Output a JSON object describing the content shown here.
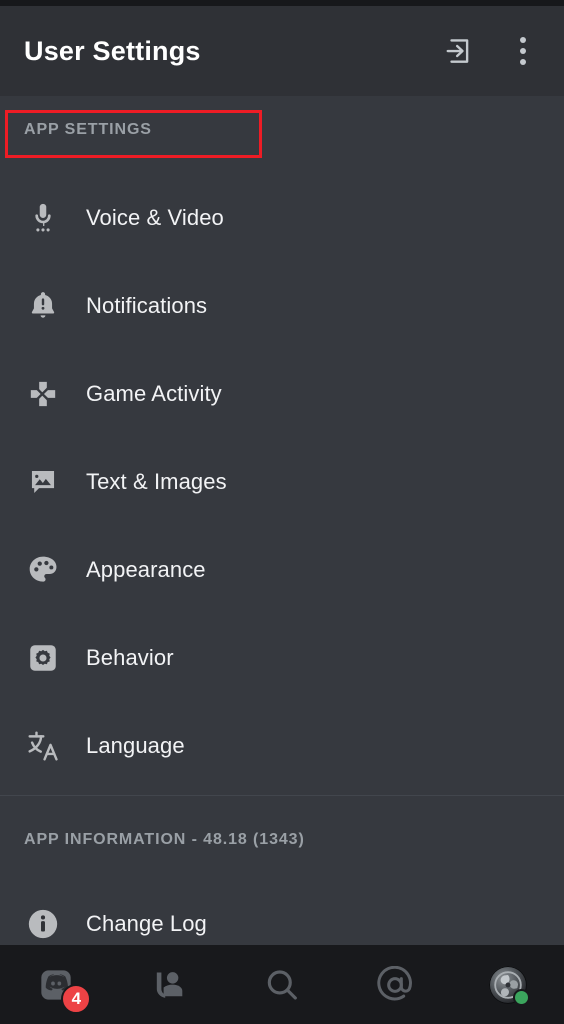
{
  "header": {
    "title": "User Settings",
    "logout_icon": "logout-icon",
    "overflow_icon": "more-vertical-icon"
  },
  "app_settings": {
    "section_label": "APP SETTINGS",
    "highlighted": true,
    "highlight_color": "#ee1c25",
    "items": [
      {
        "label": "Voice & Video",
        "icon": "microphone-icon"
      },
      {
        "label": "Notifications",
        "icon": "bell-alert-icon"
      },
      {
        "label": "Game Activity",
        "icon": "gamepad-dpad-icon"
      },
      {
        "label": "Text & Images",
        "icon": "image-message-icon"
      },
      {
        "label": "Appearance",
        "icon": "palette-icon"
      },
      {
        "label": "Behavior",
        "icon": "gear-square-icon"
      },
      {
        "label": "Language",
        "icon": "translate-icon"
      }
    ]
  },
  "app_information": {
    "section_label": "APP INFORMATION - 48.18 (1343)",
    "version": "48.18",
    "build": "1343",
    "items": [
      {
        "label": "Change Log",
        "icon": "info-circle-icon"
      }
    ]
  },
  "bottom_nav": {
    "items": [
      {
        "name": "servers",
        "icon": "discord-servers-icon",
        "badge": "4"
      },
      {
        "name": "friends",
        "icon": "friends-wave-icon",
        "badge": ""
      },
      {
        "name": "search",
        "icon": "search-icon",
        "badge": ""
      },
      {
        "name": "mentions",
        "icon": "at-mention-icon",
        "badge": ""
      },
      {
        "name": "profile",
        "icon": "avatar-icon",
        "badge": "",
        "status": "online"
      }
    ],
    "badge_color": "#ed4245",
    "online_color": "#3ba55d"
  },
  "colors": {
    "header_bg": "#2f3136",
    "content_bg": "#36393f",
    "nav_bg": "#18191c",
    "icon": "#b9bbbe",
    "label": "#f2f3f5",
    "section_label": "#9aa0a6"
  }
}
